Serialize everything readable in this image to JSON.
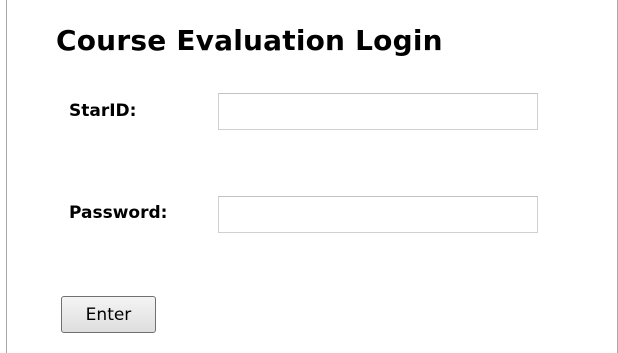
{
  "login": {
    "title": "Course Evaluation Login",
    "starid_label": "StarID:",
    "starid_value": "",
    "password_label": "Password:",
    "password_value": "",
    "enter_label": "Enter"
  }
}
